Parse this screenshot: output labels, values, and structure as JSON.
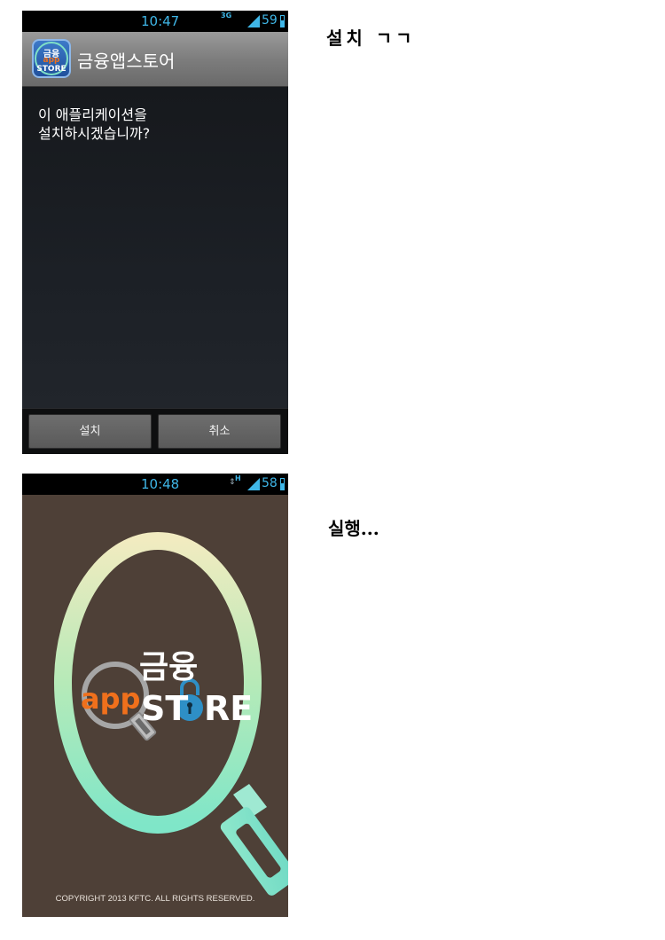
{
  "screen1": {
    "status": {
      "time": "10:47",
      "network": "3G",
      "battery": "59"
    },
    "app_icon": {
      "line1": "금융",
      "line2": "app",
      "line3": "STORE"
    },
    "app_title": "금융앱스토어",
    "message_line1": "이 애플리케이션을",
    "message_line2": "설치하시겠습니까?",
    "install_button": "설치",
    "cancel_button": "취소"
  },
  "caption1": "설치 ㄱㄱ",
  "screen2": {
    "status": {
      "time": "10:48",
      "network": "H",
      "battery": "58"
    },
    "logo": {
      "korean": "금융",
      "app": "app",
      "store_st": "ST",
      "store_re": "RE"
    },
    "copyright": "COPYRIGHT 2013 KFTC. ALL RIGHTS RESERVED."
  },
  "caption2": "실행...",
  "colors": {
    "status_accent": "#3fb7e8",
    "splash_bg": "#4e4037",
    "app_orange": "#f0701c",
    "lock_blue": "#2e8fc6"
  }
}
